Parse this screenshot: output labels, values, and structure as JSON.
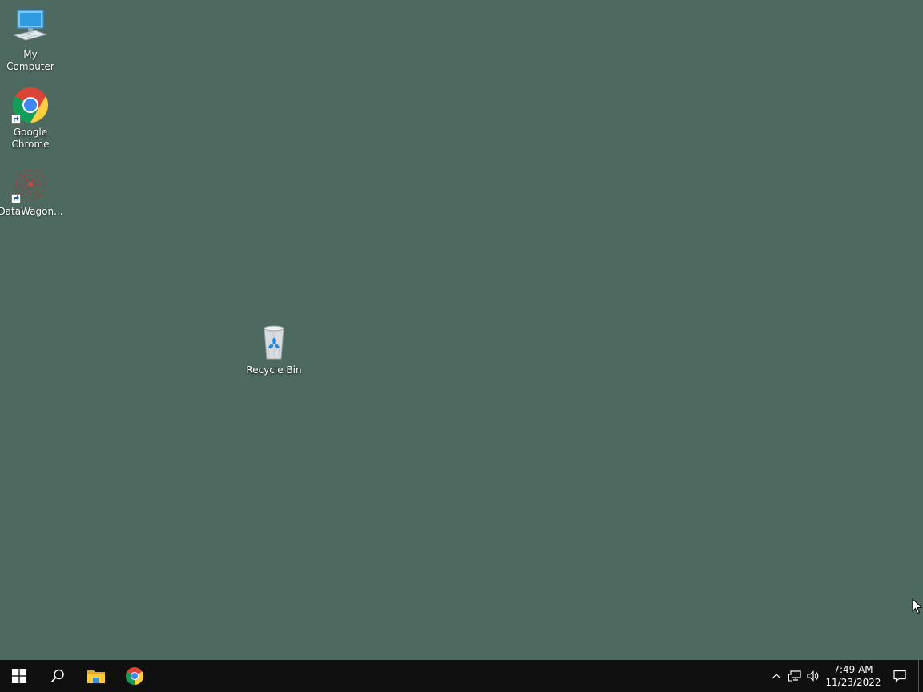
{
  "desktop": {
    "background_color": "#4e6960",
    "icons": [
      {
        "label": "My Computer",
        "icon": "computer-icon"
      },
      {
        "label": "Google Chrome",
        "icon": "chrome-icon",
        "shortcut": true
      },
      {
        "label": "DataWagon...",
        "icon": "datawagon-icon",
        "shortcut": true
      },
      {
        "label": "Recycle Bin",
        "icon": "recycle-bin-icon"
      }
    ]
  },
  "taskbar": {
    "background_color": "#101010",
    "buttons": [
      {
        "name": "start",
        "icon": "windows-logo-icon"
      },
      {
        "name": "search",
        "icon": "search-icon"
      },
      {
        "name": "file-explorer",
        "icon": "folder-icon"
      },
      {
        "name": "chrome",
        "icon": "chrome-icon"
      }
    ],
    "tray": {
      "icons": [
        "chevron-up-icon",
        "network-icon",
        "volume-icon"
      ],
      "time": "7:49 AM",
      "date": "11/23/2022",
      "notification_icon": "notification-icon"
    }
  }
}
